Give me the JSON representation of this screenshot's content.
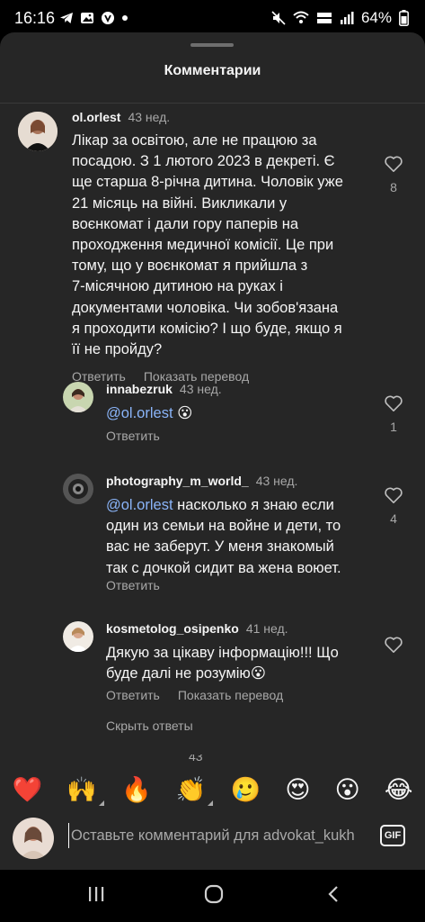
{
  "status_bar": {
    "time": "16:16",
    "battery": "64%",
    "icons": [
      "telegram-icon",
      "gallery-icon",
      "viber-icon",
      "dot-icon",
      "mute-icon",
      "wifi-icon",
      "volte-icon",
      "signal-icon"
    ]
  },
  "sheet": {
    "title": "Комментарии"
  },
  "comments": [
    {
      "username": "ol.orlest",
      "time": "43 нед.",
      "text_lines": [
        "Лікар за освітою, але не працюю за",
        "посадою. З 1 лютого 2023 в декреті. Є",
        "ще старша 8-річна дитина. Чоловік уже",
        "21 місяць на війні. Викликали у",
        "воєнкомат і дали гору паперів на",
        "проходження медичної комісії. Це при",
        "тому, що у воєнкомат я прийшла з",
        "7-місячною дитиною на руках і",
        "документами чоловіка. Чи зобов'язана",
        "я проходити комісію? І що буде, якщо я",
        "її не пройду?"
      ],
      "reply_label": "Ответить",
      "translate_label": "Показать перевод",
      "likes": "8"
    },
    {
      "username": "innabezruk",
      "time": "43 нед.",
      "mention": "@ol.orlest",
      "text": "😮",
      "reply_label": "Ответить",
      "likes": "1"
    },
    {
      "username": "photography_m_world_",
      "time": "43 нед.",
      "mention": "@ol.orlest",
      "text_first": "насколько я знаю если",
      "text_lines": [
        "один из семьи на войне и дети, то",
        "вас не заберут.  У меня знакомый",
        "так с дочкой сидит ва жена воюет."
      ],
      "reply_label": "Ответить",
      "likes": "4"
    },
    {
      "username": "kosmetolog_osipenko",
      "time": "41 нед.",
      "text_lines": [
        "Дякую за цікаву інформацію!!! Що",
        "буде далі не розумію😮"
      ],
      "reply_label": "Ответить",
      "translate_label": "Показать перевод"
    }
  ],
  "hide_replies_label": "Скрыть ответы",
  "partial_row": {
    "time": "43"
  },
  "emoji_reactions": [
    "❤️",
    "🙌",
    "🔥",
    "👏",
    "🥲",
    "😍",
    "😮",
    "😂"
  ],
  "comment_input": {
    "placeholder": "Оставьте комментарий для advokat_kukh",
    "gif_label": "GIF"
  },
  "colors": {
    "sheet_bg": "#262626",
    "mention": "#8ab4f8",
    "secondary_text": "#a8a8a8"
  }
}
